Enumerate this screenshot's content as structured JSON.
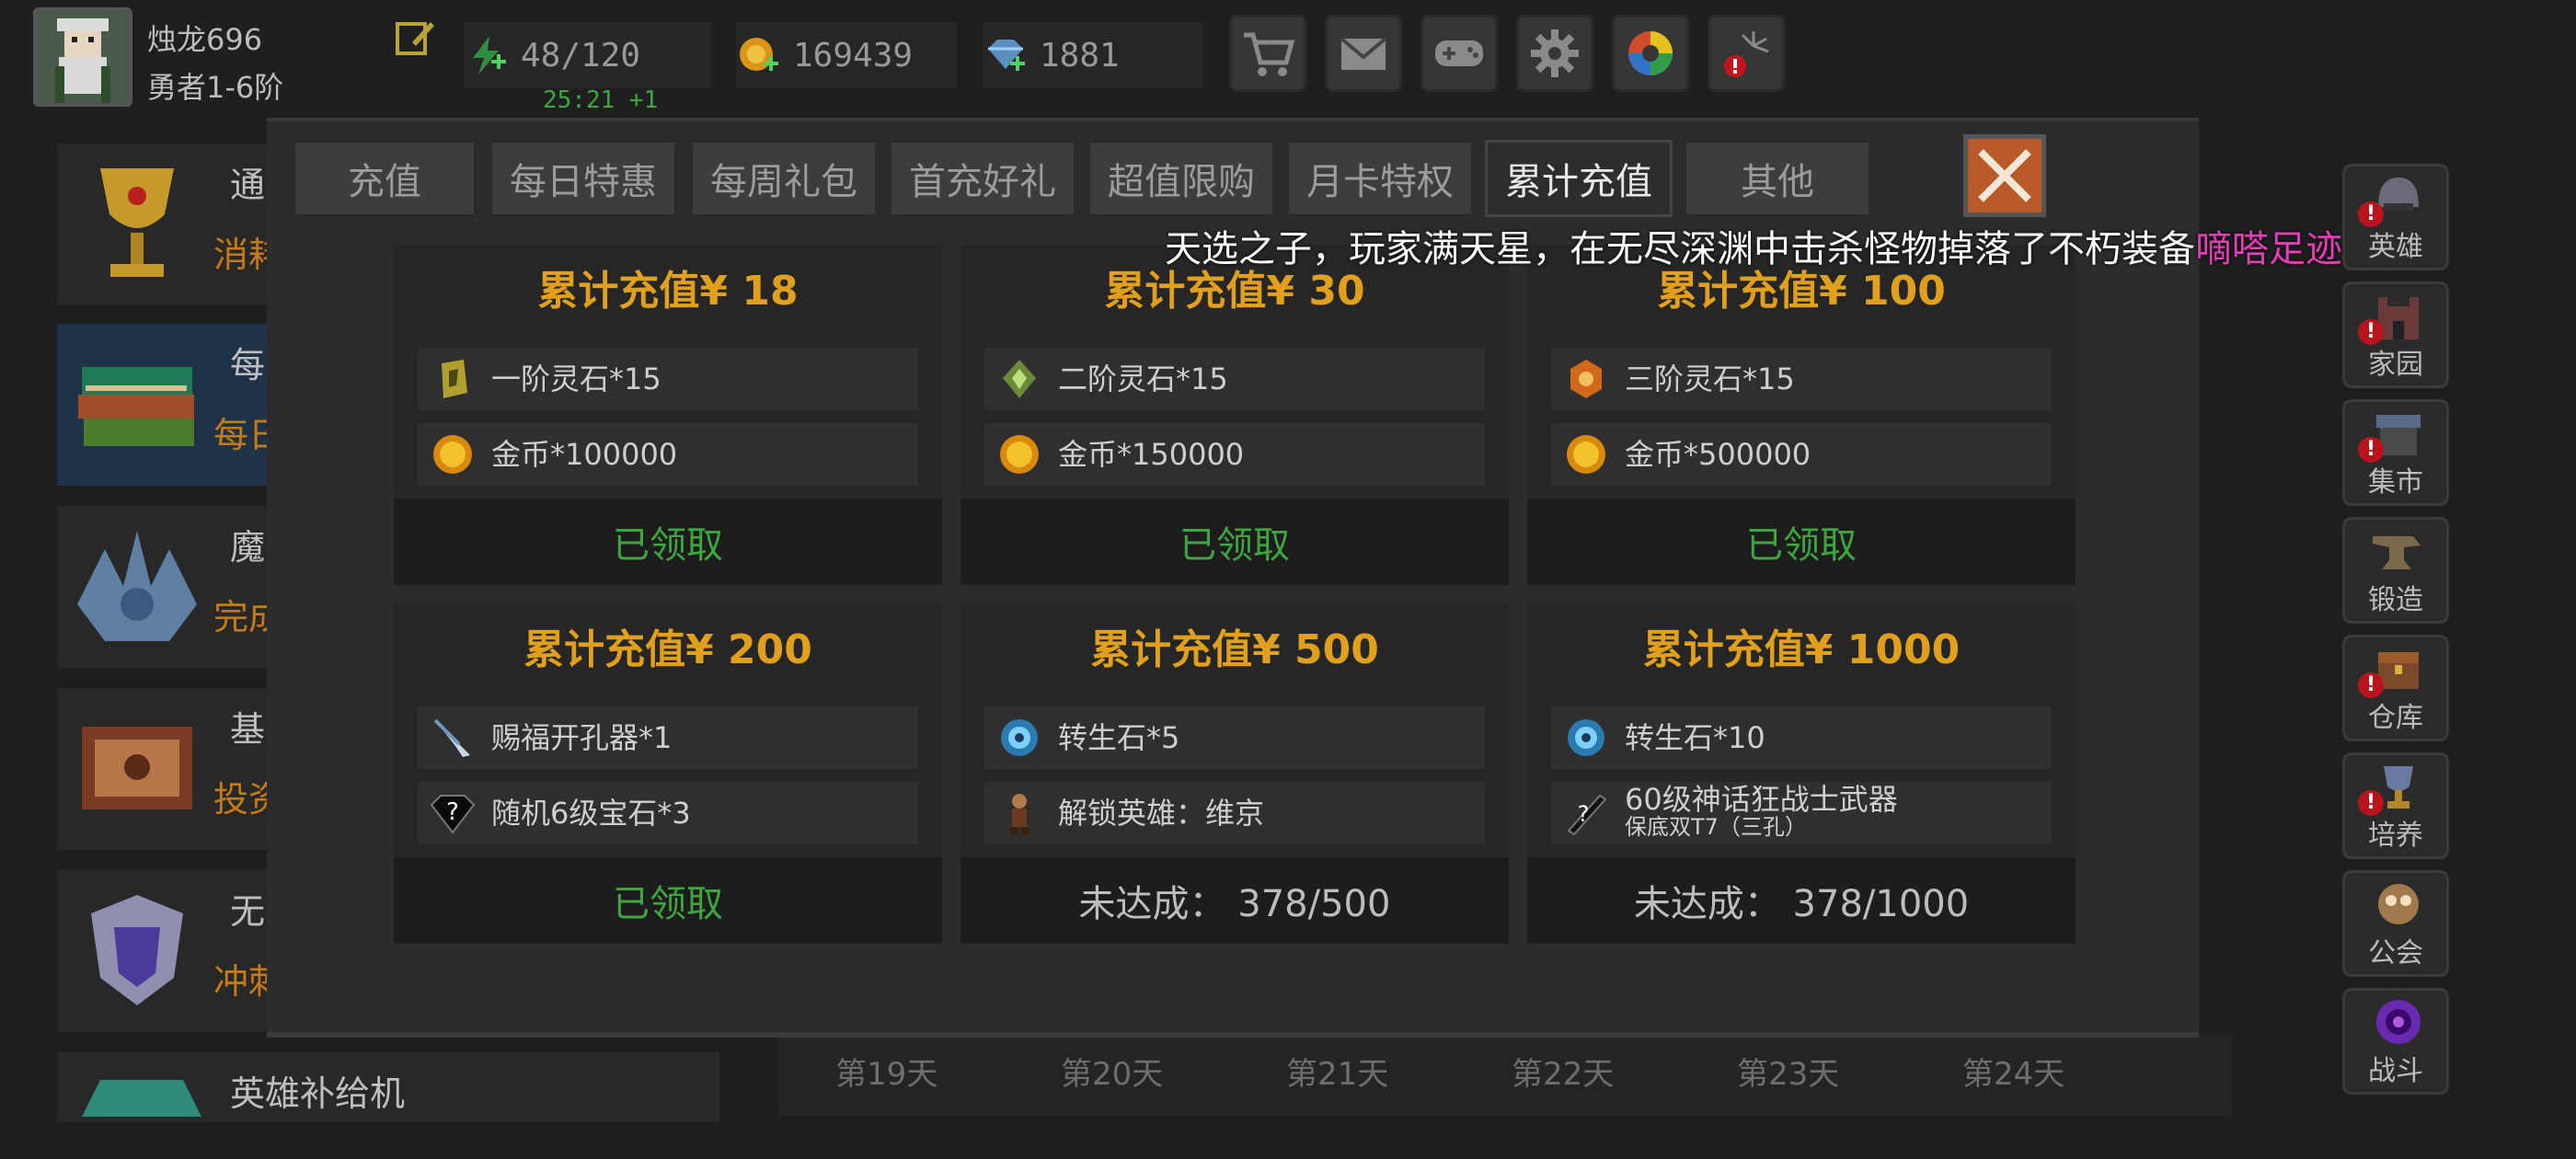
{
  "player": {
    "name": "烛龙696",
    "rank": "勇者1-6阶"
  },
  "resources": {
    "stamina": "48/120",
    "stamina_timer": "25:21 +1",
    "gold": "169439",
    "gems": "1881"
  },
  "toolbar": [
    "cart-icon",
    "mail-icon",
    "gamepad-icon",
    "gear-icon",
    "aperture-icon",
    "fireworks-icon"
  ],
  "background_list": [
    {
      "title": "通",
      "sub": "消耗"
    },
    {
      "title": "每",
      "sub": "每日"
    },
    {
      "title": "魔",
      "sub": "完成"
    },
    {
      "title": "基",
      "sub": "投资"
    },
    {
      "title": "无",
      "sub": "冲刺"
    },
    {
      "title": "英雄补给机",
      "sub": ""
    }
  ],
  "right_nav": [
    {
      "label": "英雄",
      "warn": "!"
    },
    {
      "label": "家园",
      "warn": "!"
    },
    {
      "label": "集市",
      "warn": "!"
    },
    {
      "label": "锻造",
      "warn": ""
    },
    {
      "label": "仓库",
      "warn": "!"
    },
    {
      "label": "培养",
      "warn": "!"
    },
    {
      "label": "公会",
      "warn": ""
    },
    {
      "label": "战斗",
      "warn": ""
    }
  ],
  "days": [
    "第19天",
    "第20天",
    "第21天",
    "第22天",
    "第23天",
    "第24天"
  ],
  "tabs": [
    "充值",
    "每日特惠",
    "每周礼包",
    "首充好礼",
    "超值限购",
    "月卡特权",
    "累计充值",
    "其他"
  ],
  "active_tab": "累计充值",
  "marquee": {
    "text": "天选之子，玩家满天星，在无尽深渊中击杀怪物掉落了不朽装备",
    "highlight": "嘀嗒足迹"
  },
  "cards": [
    {
      "title": "累计充值¥ 18",
      "items": [
        {
          "icon": "rune-stone-1-icon",
          "text": "一阶灵石*15",
          "sub": ""
        },
        {
          "icon": "gold-coin-icon",
          "text": "金币*100000",
          "sub": ""
        }
      ],
      "status": "已领取",
      "claimed": true
    },
    {
      "title": "累计充值¥ 30",
      "items": [
        {
          "icon": "rune-stone-2-icon",
          "text": "二阶灵石*15",
          "sub": ""
        },
        {
          "icon": "gold-coin-icon",
          "text": "金币*150000",
          "sub": ""
        }
      ],
      "status": "已领取",
      "claimed": true
    },
    {
      "title": "累计充值¥ 100",
      "items": [
        {
          "icon": "rune-stone-3-icon",
          "text": "三阶灵石*15",
          "sub": ""
        },
        {
          "icon": "gold-coin-icon",
          "text": "金币*500000",
          "sub": ""
        }
      ],
      "status": "已领取",
      "claimed": true
    },
    {
      "title": "累计充值¥ 200",
      "items": [
        {
          "icon": "drill-icon",
          "text": "赐福开孔器*1",
          "sub": ""
        },
        {
          "icon": "mystery-gem-icon",
          "text": "随机6级宝石*3",
          "sub": ""
        }
      ],
      "status": "已领取",
      "claimed": true
    },
    {
      "title": "累计充值¥ 500",
      "items": [
        {
          "icon": "rebirth-stone-icon",
          "text": "转生石*5",
          "sub": ""
        },
        {
          "icon": "hero-viking-icon",
          "text": "解锁英雄：维京",
          "sub": ""
        }
      ],
      "status": "未达成： 378/500",
      "claimed": false
    },
    {
      "title": "累计充值¥ 1000",
      "items": [
        {
          "icon": "rebirth-stone-icon",
          "text": "转生石*10",
          "sub": ""
        },
        {
          "icon": "mystery-weapon-icon",
          "text": "60级神话狂战士武器",
          "sub": "保底双T7（三孔）"
        }
      ],
      "status": "未达成： 378/1000",
      "claimed": false
    }
  ],
  "colors": {
    "claimed": "#3ea63e",
    "title_gold": "#e0a01d",
    "highlight": "#e23fb7",
    "close": "#b85a2a"
  }
}
